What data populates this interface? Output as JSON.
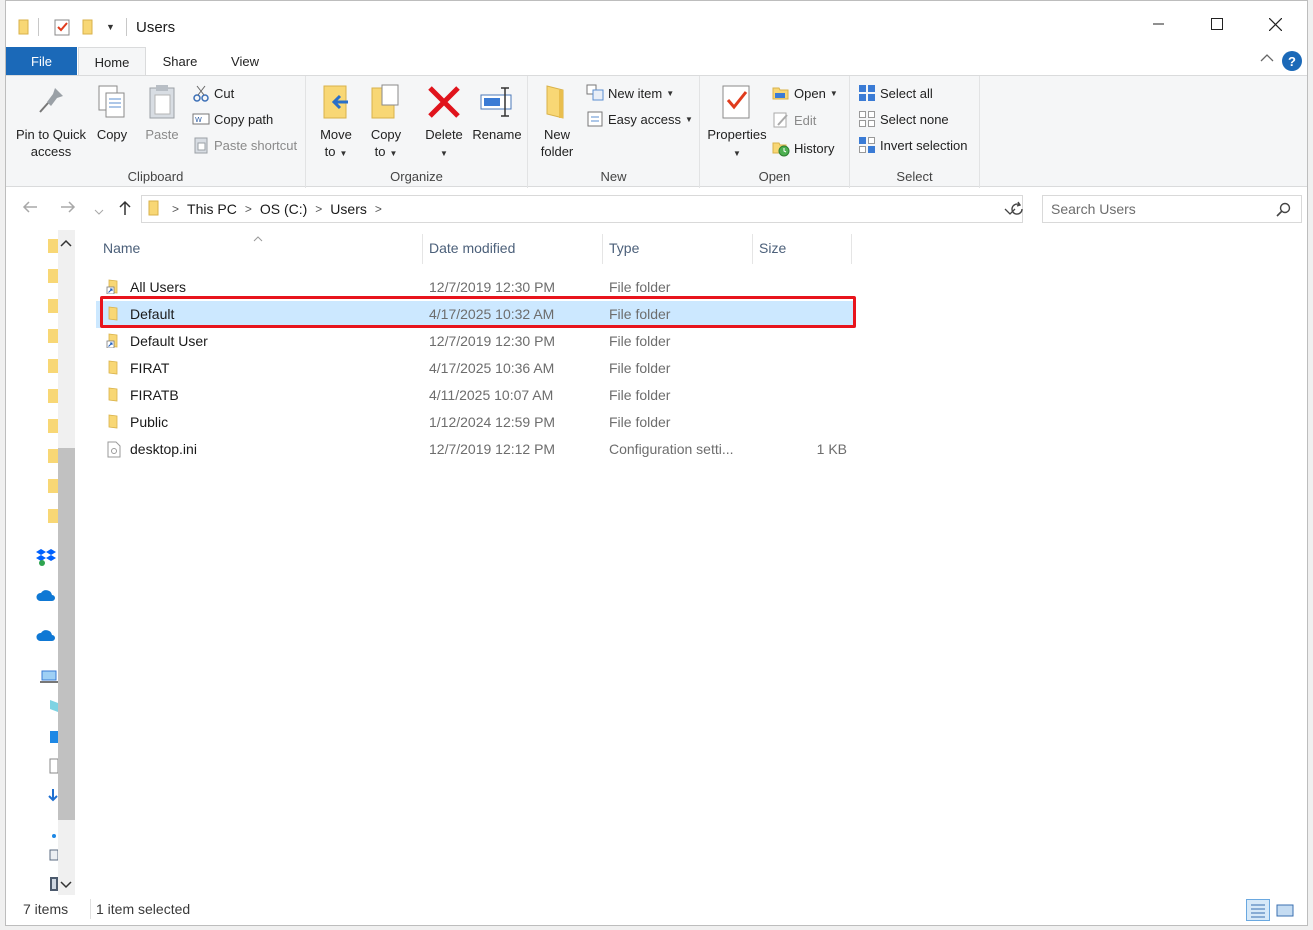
{
  "window": {
    "title": "Users"
  },
  "tabs": {
    "file": "File",
    "home": "Home",
    "share": "Share",
    "view": "View",
    "help": "?"
  },
  "ribbon": {
    "clipboard": {
      "label": "Clipboard",
      "pin": "Pin to Quick access",
      "pin_l1": "Pin to Quick",
      "pin_l2": "access",
      "copy": "Copy",
      "paste": "Paste",
      "cut": "Cut",
      "copy_path": "Copy path",
      "paste_shortcut": "Paste shortcut"
    },
    "organize": {
      "label": "Organize",
      "move_l1": "Move",
      "move_l2": "to",
      "copy_l1": "Copy",
      "copy_l2": "to",
      "delete": "Delete",
      "rename": "Rename"
    },
    "new": {
      "label": "New",
      "folder_l1": "New",
      "folder_l2": "folder",
      "new_item": "New item",
      "easy_access": "Easy access"
    },
    "open": {
      "label": "Open",
      "properties": "Properties",
      "open": "Open",
      "edit": "Edit",
      "history": "History"
    },
    "select": {
      "label": "Select",
      "select_all": "Select all",
      "select_none": "Select none",
      "invert": "Invert selection"
    }
  },
  "address": {
    "crumbs": [
      "This PC",
      "OS (C:)",
      "Users"
    ],
    "search_placeholder": "Search Users"
  },
  "columns": {
    "name": "Name",
    "date": "Date modified",
    "type": "Type",
    "size": "Size"
  },
  "files": [
    {
      "name": "All Users",
      "date": "12/7/2019 12:30 PM",
      "type": "File folder",
      "size": "",
      "icon": "folder-shortcut-icon"
    },
    {
      "name": "Default",
      "date": "4/17/2025 10:32 AM",
      "type": "File folder",
      "size": "",
      "icon": "folder-icon",
      "selected": true
    },
    {
      "name": "Default User",
      "date": "12/7/2019 12:30 PM",
      "type": "File folder",
      "size": "",
      "icon": "folder-shortcut-icon"
    },
    {
      "name": "FIRAT",
      "date": "4/17/2025 10:36 AM",
      "type": "File folder",
      "size": "",
      "icon": "folder-icon"
    },
    {
      "name": "FIRATB",
      "date": "4/11/2025 10:07 AM",
      "type": "File folder",
      "size": "",
      "icon": "folder-icon"
    },
    {
      "name": "Public",
      "date": "1/12/2024 12:59 PM",
      "type": "File folder",
      "size": "",
      "icon": "folder-icon"
    },
    {
      "name": "desktop.ini",
      "date": "12/7/2019 12:12 PM",
      "type": "Configuration setti...",
      "size": "1 KB",
      "icon": "settings-file-icon"
    }
  ],
  "status": {
    "count": "7 items",
    "selection": "1 item selected"
  },
  "colors": {
    "accent": "#1b69b8",
    "selection": "#cce8ff",
    "highlight": "#e8141c",
    "folder": "#f8d775"
  }
}
